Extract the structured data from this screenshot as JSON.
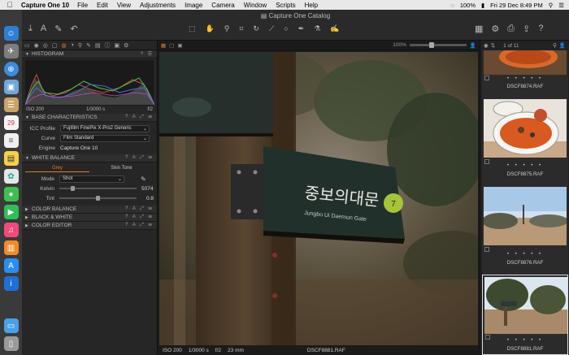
{
  "menubar": {
    "app": "Capture One 10",
    "items": [
      "File",
      "Edit",
      "View",
      "Adjustments",
      "Image",
      "Camera",
      "Window",
      "Scripts",
      "Help"
    ],
    "battery": "100%",
    "clock": "Fri 29 Dec 8:49 PM"
  },
  "window": {
    "title": "Capture One Catalog"
  },
  "left": {
    "histogram": {
      "title": "HISTOGRAM",
      "iso": "ISO 200",
      "shutter": "1/3000 s",
      "aperture": "f/2"
    },
    "base": {
      "title": "BASE CHARACTERISTICS",
      "icc_label": "ICC Profile",
      "icc_value": "Fujifilm FinePix X-Pro2 Generic",
      "curve_label": "Curve",
      "curve_value": "Film Standard",
      "engine_label": "Engine",
      "engine_value": "Capture One 10"
    },
    "wb": {
      "title": "WHITE BALANCE",
      "tab_grey": "Grey",
      "tab_skin": "Skin Tone",
      "mode_label": "Mode",
      "mode_value": "Shot",
      "kelvin_label": "Kelvin",
      "kelvin_value": "5074",
      "kelvin_frac": 0.16,
      "tint_label": "Tint",
      "tint_value": "0.8",
      "tint_frac": 0.5
    },
    "collapsed": [
      "COLOR BALANCE",
      "BLACK & WHITE",
      "COLOR EDITOR"
    ]
  },
  "viewer": {
    "zoom": "100%",
    "status": {
      "iso": "ISO 200",
      "shutter": "1/3000 s",
      "aperture": "f/2",
      "focal": "23 mm",
      "file": "DSCF8881.RAF"
    },
    "sign_text_ko": "중보의대문",
    "sign_text_en": "Jungbo Ui Daemun Gate",
    "sign_number": "7"
  },
  "browser": {
    "count": "1 of 11",
    "thumbs": [
      {
        "name": "DSCF8874.RAF"
      },
      {
        "name": "DSCF8875.RAF"
      },
      {
        "name": "DSCF8876.RAF"
      },
      {
        "name": "DSCF8881.RAF"
      }
    ]
  },
  "colors": {
    "accent": "#e07a2c"
  }
}
